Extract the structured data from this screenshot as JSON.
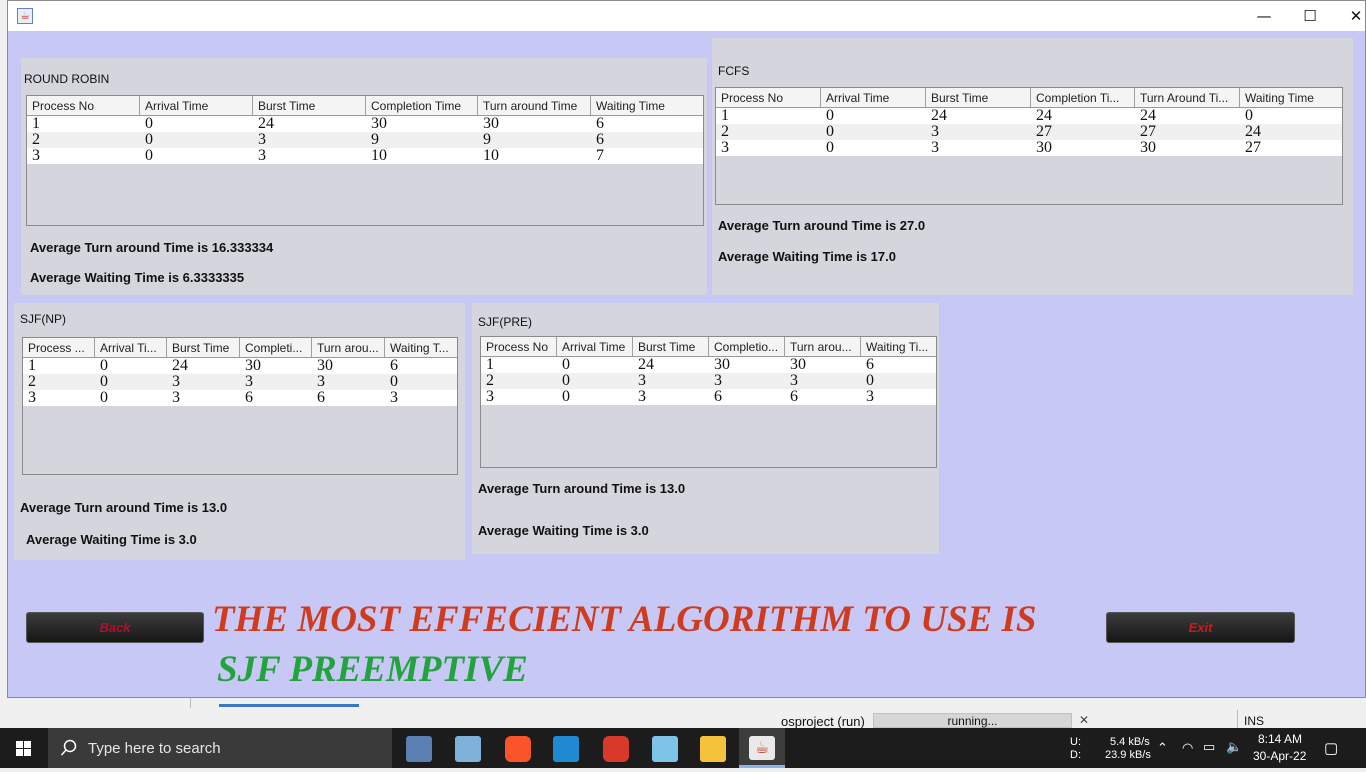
{
  "window": {
    "minimize_glyph": "—",
    "maximize_glyph": "☐",
    "close_glyph": "✕"
  },
  "round_robin": {
    "title": "ROUND ROBIN",
    "headers": [
      "Process No",
      "Arrival Time",
      "Burst Time",
      "Completion Time",
      "Turn around Time",
      "Waiting Time"
    ],
    "rows": [
      [
        "1",
        "0",
        "24",
        "30",
        "30",
        "6"
      ],
      [
        "2",
        "0",
        "3",
        "9",
        "9",
        "6"
      ],
      [
        "3",
        "0",
        "3",
        "10",
        "10",
        "7"
      ]
    ],
    "avg_tat": "Average Turn around Time is 16.333334",
    "avg_wt": "Average Waiting Time is 6.3333335"
  },
  "fcfs": {
    "title": "FCFS",
    "headers": [
      "Process No",
      "Arrival Time",
      "Burst Time",
      "Completion Ti...",
      "Turn Around Ti...",
      "Waiting Time"
    ],
    "rows": [
      [
        "1",
        "0",
        "24",
        "24",
        "24",
        "0"
      ],
      [
        "2",
        "0",
        "3",
        "27",
        "27",
        "24"
      ],
      [
        "3",
        "0",
        "3",
        "30",
        "30",
        "27"
      ]
    ],
    "avg_tat": "Average Turn around Time is 27.0",
    "avg_wt": "Average Waiting Time is 17.0"
  },
  "sjf_np": {
    "title": "SJF(NP)",
    "headers": [
      "Process ...",
      "Arrival Ti...",
      "Burst Time",
      "Completi...",
      "Turn arou...",
      "Waiting T..."
    ],
    "rows": [
      [
        "1",
        "0",
        "24",
        "30",
        "30",
        "6"
      ],
      [
        "2",
        "0",
        "3",
        "3",
        "3",
        "0"
      ],
      [
        "3",
        "0",
        "3",
        "6",
        "6",
        "3"
      ]
    ],
    "avg_tat": "Average Turn around Time is 13.0",
    "avg_wt": "Average Waiting Time is 3.0"
  },
  "sjf_pre": {
    "title": "SJF(PRE)",
    "headers": [
      "Process No",
      "Arrival Time",
      "Burst Time",
      "Completio...",
      "Turn arou...",
      "Waiting Ti..."
    ],
    "rows": [
      [
        "1",
        "0",
        "24",
        "30",
        "30",
        "6"
      ],
      [
        "2",
        "0",
        "3",
        "3",
        "3",
        "0"
      ],
      [
        "3",
        "0",
        "3",
        "6",
        "6",
        "3"
      ]
    ],
    "avg_tat": "Average Turn around Time is 13.0",
    "avg_wt": "Average Waiting Time is 3.0"
  },
  "buttons": {
    "back": "Back",
    "exit": "Exit",
    "back_color": "#b0102a",
    "exit_color": "#d01818"
  },
  "conclusion": {
    "line1": "THE MOST EFFECIENT ALGORITHM TO USE IS",
    "line2": "SJF PREEMPTIVE"
  },
  "ide": {
    "run_label": "osproject (run)",
    "status": "running...",
    "close_glyph": "✕",
    "mode": "INS"
  },
  "taskbar": {
    "search_placeholder": "Type here to search",
    "upload_label": "U:",
    "download_label": "D:",
    "upload_speed": "5.4 kB/s",
    "download_speed": "23.9 kB/s",
    "time": "8:14 AM",
    "date": "30-Apr-22"
  }
}
